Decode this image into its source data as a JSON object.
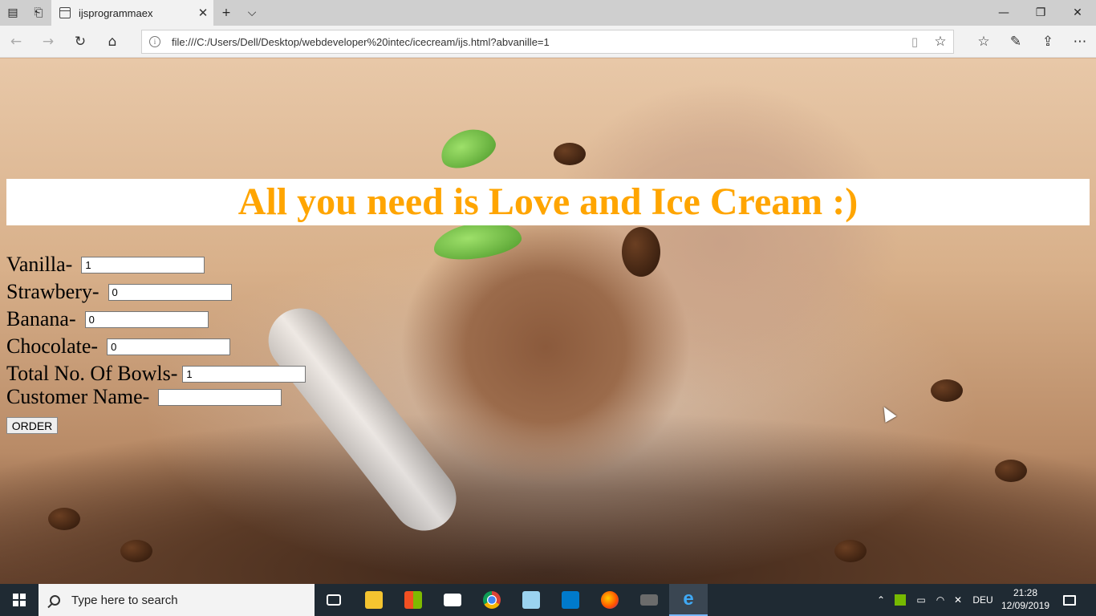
{
  "browser": {
    "tab_title": "ijsprogrammaex",
    "url": "file:///C:/Users/Dell/Desktop/webdeveloper%20intec/icecream/ijs.html?abvanille=1",
    "new_tab_symbol": "+",
    "tab_list_symbol": "⌵"
  },
  "page": {
    "heading": "All you need is Love and Ice Cream :)",
    "fields": [
      {
        "label": "Vanilla-",
        "value": "1"
      },
      {
        "label": "Strawbery-",
        "value": "0"
      },
      {
        "label": "Banana-",
        "value": "0"
      },
      {
        "label": "Chocolate-",
        "value": "0"
      },
      {
        "label": "Total No. Of Bowls-",
        "value": "1"
      },
      {
        "label": "Customer Name-",
        "value": ""
      }
    ],
    "order_button": "ORDER",
    "heading_color": "#ffa500"
  },
  "taskbar": {
    "search_placeholder": "Type here to search",
    "language": "DEU",
    "time": "21:28",
    "date": "12/09/2019",
    "apps": [
      "task-view-icon",
      "file-explorer-icon",
      "store-icon",
      "mail-icon",
      "chrome-icon",
      "notepad-icon",
      "vscode-icon",
      "firefox-icon",
      "game-icon",
      "edge-icon"
    ]
  }
}
